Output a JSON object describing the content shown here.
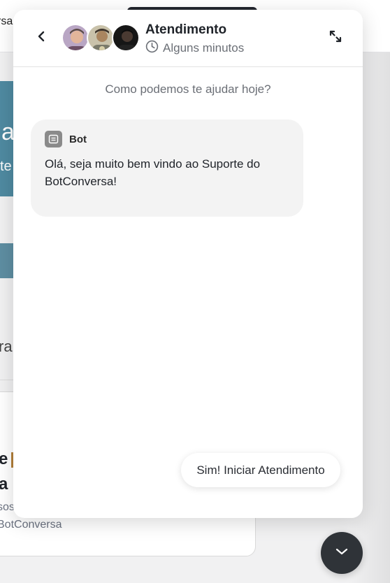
{
  "background": {
    "brand_fragment": "rsa",
    "banner_big_fragment": "a",
    "banner_small_fragment": "te",
    "section_fragment": "ra",
    "card_line1_fragment": "e",
    "card_line2_fragment": "a",
    "card_text_fragment": "sos",
    "card_brand_fragment": "BotConversa"
  },
  "chat": {
    "header": {
      "title": "Atendimento",
      "subtitle": "Alguns minutos",
      "back_icon": "chevron-left-icon",
      "expand_icon": "expand-arrows-icon",
      "clock_icon": "clock-icon"
    },
    "avatars": [
      "agent-avatar-1",
      "agent-avatar-2",
      "agent-avatar-3"
    ],
    "prompt": "Como podemos te ajudar hoje?",
    "bot_message": {
      "sender": "Bot",
      "text": "Olá, seja muito bem vindo ao Suporte do BotConversa!",
      "icon": "bot-icon"
    },
    "quick_reply": "Sim! Iniciar Atendimento"
  },
  "launcher": {
    "icon": "chevron-down-icon"
  },
  "colors": {
    "widget_bg": "#ffffff",
    "bubble_bg": "#f3f3f3",
    "launcher_bg": "#2f3338",
    "banner_teal": "#4f8aa1"
  }
}
